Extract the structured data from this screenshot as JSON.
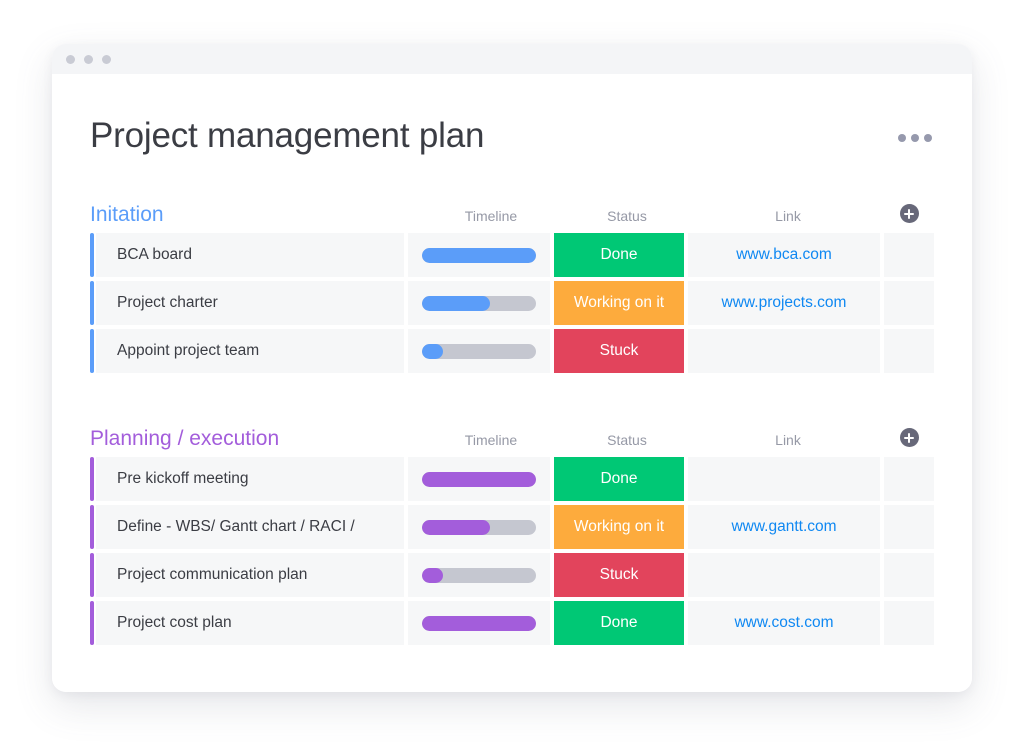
{
  "window": {
    "titlebar_dots": [
      "dot-1",
      "dot-2",
      "dot-3"
    ]
  },
  "header": {
    "title": "Project management plan",
    "menu_icon": "kebab-menu-icon"
  },
  "columns": {
    "timeline": "Timeline",
    "status": "Status",
    "link": "Link",
    "add": "add-column-icon"
  },
  "colors": {
    "initation_accent": "#5b9df9",
    "planning_accent": "#a35ddb",
    "status_done": "#00c875",
    "status_working": "#fdab3d",
    "status_stuck": "#e2445c",
    "link": "#0f88f2",
    "bar_track": "#c5c7d0",
    "row_bg": "#f6f7f8",
    "title": "#3b3d44"
  },
  "sections": [
    {
      "title": "Initation",
      "accent": "blue",
      "rows": [
        {
          "name": "BCA board",
          "progress": 100,
          "status": "Done",
          "status_key": "done",
          "link": "www.bca.com"
        },
        {
          "name": "Project charter",
          "progress": 60,
          "status": "Working on it",
          "status_key": "working",
          "link": "www.projects.com"
        },
        {
          "name": "Appoint project team",
          "progress": 18,
          "status": "Stuck",
          "status_key": "stuck",
          "link": ""
        }
      ]
    },
    {
      "title": "Planning / execution",
      "accent": "purple",
      "rows": [
        {
          "name": "Pre kickoff meeting",
          "progress": 100,
          "status": "Done",
          "status_key": "done",
          "link": ""
        },
        {
          "name": "Define - WBS/ Gantt chart / RACI /",
          "progress": 60,
          "status": "Working on it",
          "status_key": "working",
          "link": "www.gantt.com"
        },
        {
          "name": "Project communication plan",
          "progress": 18,
          "status": "Stuck",
          "status_key": "stuck",
          "link": ""
        },
        {
          "name": "Project cost plan",
          "progress": 100,
          "status": "Done",
          "status_key": "done",
          "link": "www.cost.com"
        }
      ]
    }
  ]
}
